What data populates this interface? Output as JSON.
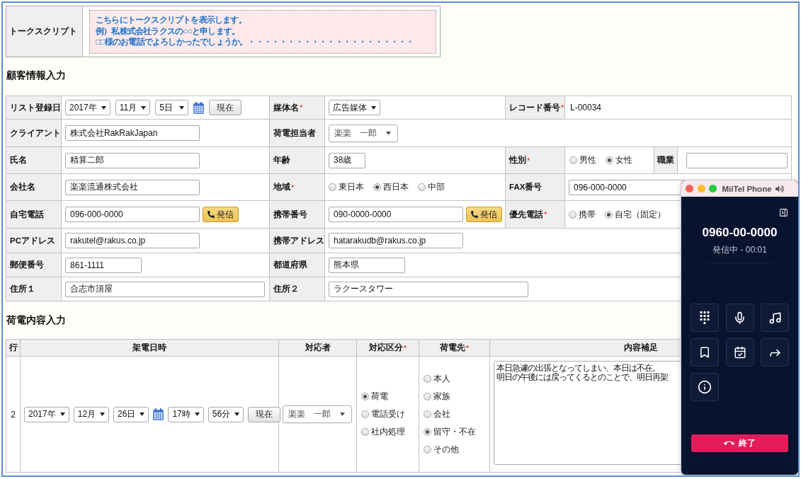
{
  "talk_script": {
    "label": "トークスクリプト",
    "lines": [
      "こちらにトークスクリプトを表示します。",
      "例）私株式会社ラクスの○○と申します。",
      "□□様のお電話でよろしかったでしょうか。・・・・・・・・・・・・・・・・・・・・・"
    ]
  },
  "customer_info": {
    "heading": "顧客情報入力",
    "rows": [
      [
        {
          "label": "リスト登録日",
          "field": {
            "kind": "date",
            "selects": [
              "2017年",
              "11月",
              "5日"
            ],
            "button": "現在"
          }
        },
        {
          "label": "媒体名",
          "required_mark": "*",
          "field": {
            "kind": "select",
            "value": "広告媒体"
          }
        },
        {
          "label": "レコード番号",
          "required_mark": "*",
          "field": {
            "kind": "text",
            "value": "L-00034"
          }
        }
      ],
      [
        {
          "label": "クライアント",
          "field": {
            "kind": "input",
            "value": "株式会社RakRakJapan"
          }
        },
        {
          "label": "荷電担当者",
          "field": {
            "kind": "combo",
            "value": "楽楽　一郎"
          }
        }
      ],
      [
        {
          "label": "氏名",
          "field": {
            "kind": "input",
            "value": "精算二郎"
          }
        },
        {
          "label": "年齢",
          "field": {
            "kind": "input",
            "value": "38歳"
          }
        },
        {
          "label": "性別",
          "required_mark": "*",
          "field": {
            "kind": "radio",
            "options": [
              {
                "label": "男性",
                "selected": false
              },
              {
                "label": "女性",
                "selected": true
              }
            ]
          },
          "extra": {
            "label": "職業",
            "field": {
              "kind": "input"
            }
          }
        }
      ],
      [
        {
          "label": "会社名",
          "field": {
            "kind": "input",
            "value": "楽楽流通株式会社"
          }
        },
        {
          "label": "地域",
          "required_mark": "*",
          "field": {
            "kind": "radio",
            "options": [
              {
                "label": "東日本",
                "selected": false
              },
              {
                "label": "西日本",
                "selected": true
              },
              {
                "label": "中部",
                "selected": false
              }
            ]
          }
        },
        {
          "label": "FAX番号",
          "field": {
            "kind": "input",
            "value": "096-000-0000"
          }
        }
      ],
      [
        {
          "label": "自宅電話",
          "field": {
            "kind": "phone",
            "value": "096-000-0000",
            "button": "発信"
          }
        },
        {
          "label": "携帯番号",
          "field": {
            "kind": "phone",
            "value": "090-0000-0000",
            "button": "発信"
          }
        },
        {
          "label": "優先電話",
          "required_mark": "*",
          "field": {
            "kind": "radio",
            "options": [
              {
                "label": "携帯",
                "selected": false
              },
              {
                "label": "自宅（固定）",
                "selected": true
              }
            ]
          }
        }
      ],
      [
        {
          "label": "PCアドレス",
          "field": {
            "kind": "input",
            "value": "rakutel@rakus.co.jp"
          }
        },
        {
          "label": "携帯アドレス",
          "field": {
            "kind": "input",
            "value": "hatarakudb@rakus.co.jp"
          }
        }
      ],
      [
        {
          "label": "郵便番号",
          "field": {
            "kind": "input",
            "value": "861-1111"
          }
        },
        {
          "label": "都道府県",
          "field": {
            "kind": "input",
            "value": "熊本県"
          }
        }
      ],
      [
        {
          "label": "住所１",
          "field": {
            "kind": "input",
            "value": "合志市須屋"
          }
        },
        {
          "label": "住所２",
          "field": {
            "kind": "input",
            "value": "ラクースタワー"
          }
        }
      ]
    ]
  },
  "call_content": {
    "heading": "荷電内容入力",
    "columns": [
      {
        "label": "行"
      },
      {
        "label": "架電日時"
      },
      {
        "label": "対応者"
      },
      {
        "label": "対応区分",
        "required_mark": "*"
      },
      {
        "label": "荷電先",
        "required_mark": "*"
      },
      {
        "label": "内容補足"
      }
    ],
    "rows": [
      {
        "number": "2",
        "date_selects": [
          "2017年",
          "12月",
          "26日"
        ],
        "time_selects": [
          "17時",
          "56分"
        ],
        "now_button": "現在",
        "responder": "楽楽　一郎",
        "response_type": [
          {
            "label": "荷電",
            "selected": true
          },
          {
            "label": "電話受け",
            "selected": false
          },
          {
            "label": "社内処理",
            "selected": false
          }
        ],
        "callee": [
          {
            "label": "本人",
            "selected": false
          },
          {
            "label": "家族",
            "selected": false
          },
          {
            "label": "会社",
            "selected": false
          },
          {
            "label": "留守・不在",
            "selected": true
          },
          {
            "label": "その他",
            "selected": false
          }
        ],
        "memo_lines": [
          "本日急遽の出張となってしまい、本日は不在。",
          "明日の午後には戻ってくるとのことで、明日再架"
        ]
      }
    ]
  },
  "phone_widget": {
    "title": "MiiTel Phone",
    "number": "0960-00-0000",
    "status": "発信中 - 00:01",
    "end_button": "終了"
  }
}
